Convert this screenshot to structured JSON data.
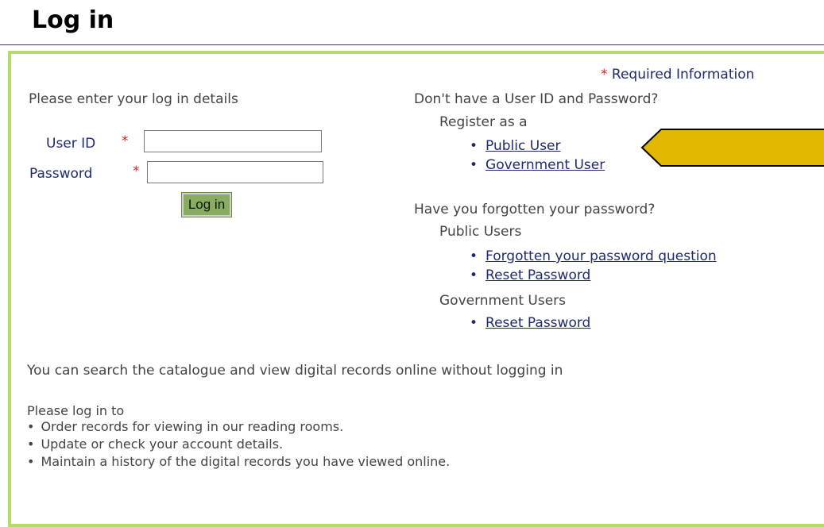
{
  "page": {
    "title": "Log in"
  },
  "required_note": {
    "star": "*",
    "text": "Required Information"
  },
  "login_form": {
    "intro": "Please enter your log in details",
    "user_id_label": "User ID",
    "password_label": "Password",
    "required_star": "*",
    "user_id_value": "",
    "password_value": "",
    "login_button": "Log in"
  },
  "register": {
    "question": "Don't have a User ID and Password?",
    "prompt": "Register as a",
    "links": [
      "Public User",
      "Government User"
    ]
  },
  "forgotten": {
    "question": "Have you forgotten your password?",
    "public_heading": "Public Users",
    "public_links": [
      "Forgotten your password question",
      "Reset Password"
    ],
    "government_heading": "Government Users",
    "government_links": [
      "Reset Password"
    ]
  },
  "browse_note": "You can search the catalogue and view digital records online without logging in",
  "login_benefits": {
    "intro": "Please log in to",
    "items": [
      "Order records for viewing in our reading rooms.",
      "Update or check your account details.",
      "Maintain a history of the digital records you have viewed online."
    ]
  },
  "colors": {
    "panel_border": "#b4dc6a",
    "link": "#1f2a6e",
    "required_star": "#e02020",
    "button_bg": "#88ad60",
    "callout_arrow": "#e2b700"
  },
  "icons": {
    "callout": "arrow-pointer-icon"
  }
}
